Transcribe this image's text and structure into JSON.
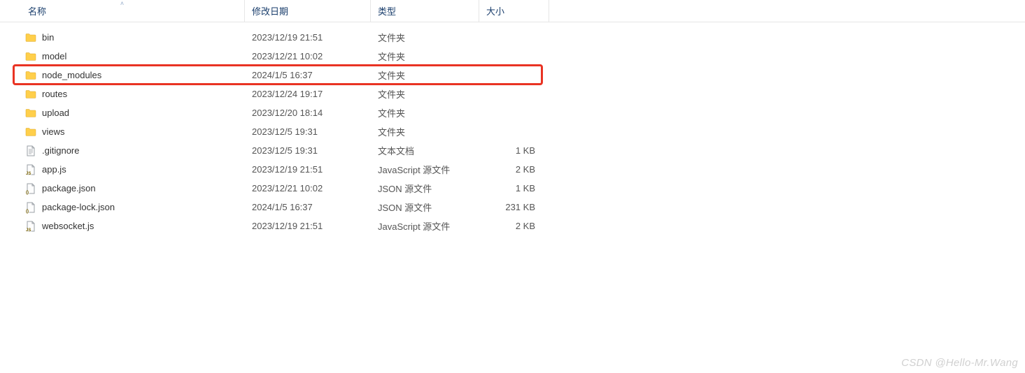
{
  "columns": {
    "name": "名称",
    "date": "修改日期",
    "type": "类型",
    "size": "大小"
  },
  "rows": [
    {
      "icon": "folder",
      "name": "bin",
      "date": "2023/12/19 21:51",
      "type": "文件夹",
      "size": "",
      "highlighted": false
    },
    {
      "icon": "folder",
      "name": "model",
      "date": "2023/12/21 10:02",
      "type": "文件夹",
      "size": "",
      "highlighted": false
    },
    {
      "icon": "folder",
      "name": "node_modules",
      "date": "2024/1/5 16:37",
      "type": "文件夹",
      "size": "",
      "highlighted": true
    },
    {
      "icon": "folder",
      "name": "routes",
      "date": "2023/12/24 19:17",
      "type": "文件夹",
      "size": "",
      "highlighted": false
    },
    {
      "icon": "folder",
      "name": "upload",
      "date": "2023/12/20 18:14",
      "type": "文件夹",
      "size": "",
      "highlighted": false
    },
    {
      "icon": "folder",
      "name": "views",
      "date": "2023/12/5 19:31",
      "type": "文件夹",
      "size": "",
      "highlighted": false
    },
    {
      "icon": "textdoc",
      "name": ".gitignore",
      "date": "2023/12/5 19:31",
      "type": "文本文档",
      "size": "1 KB",
      "highlighted": false
    },
    {
      "icon": "js",
      "name": "app.js",
      "date": "2023/12/19 21:51",
      "type": "JavaScript 源文件",
      "size": "2 KB",
      "highlighted": false
    },
    {
      "icon": "json",
      "name": "package.json",
      "date": "2023/12/21 10:02",
      "type": "JSON 源文件",
      "size": "1 KB",
      "highlighted": false
    },
    {
      "icon": "json",
      "name": "package-lock.json",
      "date": "2024/1/5 16:37",
      "type": "JSON 源文件",
      "size": "231 KB",
      "highlighted": false
    },
    {
      "icon": "js",
      "name": "websocket.js",
      "date": "2023/12/19 21:51",
      "type": "JavaScript 源文件",
      "size": "2 KB",
      "highlighted": false
    }
  ],
  "watermark": "CSDN @Hello-Mr.Wang"
}
